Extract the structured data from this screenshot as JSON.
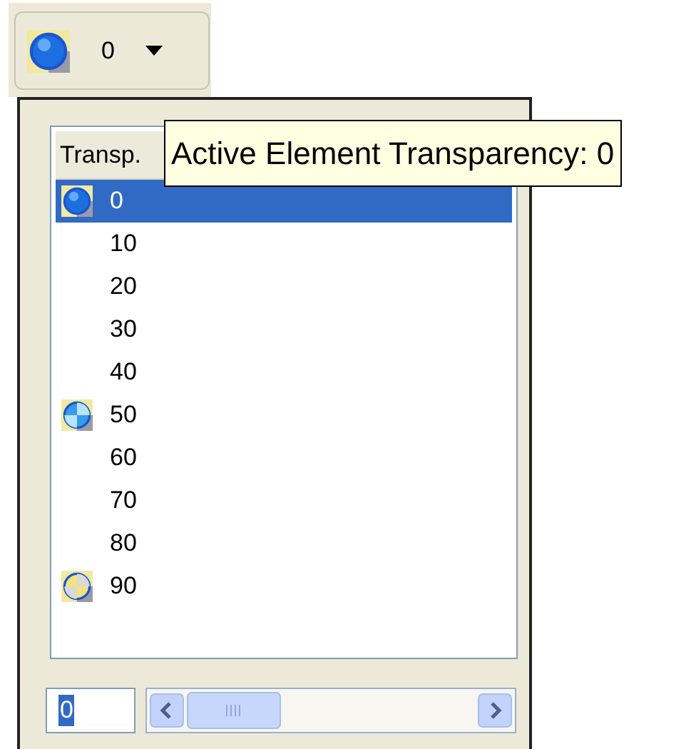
{
  "dropdown_button": {
    "value": "0",
    "kind": "full"
  },
  "list": {
    "column_header": "Transp.",
    "items": [
      {
        "label": "0",
        "kind": "full",
        "selected": true
      },
      {
        "label": "10",
        "kind": "none",
        "selected": false
      },
      {
        "label": "20",
        "kind": "none",
        "selected": false
      },
      {
        "label": "30",
        "kind": "none",
        "selected": false
      },
      {
        "label": "40",
        "kind": "none",
        "selected": false
      },
      {
        "label": "50",
        "kind": "half",
        "selected": false
      },
      {
        "label": "60",
        "kind": "none",
        "selected": false
      },
      {
        "label": "70",
        "kind": "none",
        "selected": false
      },
      {
        "label": "80",
        "kind": "none",
        "selected": false
      },
      {
        "label": "90",
        "kind": "clear",
        "selected": false
      }
    ]
  },
  "tooltip": "Active Element Transparency: 0",
  "value_field": {
    "value": "0"
  }
}
